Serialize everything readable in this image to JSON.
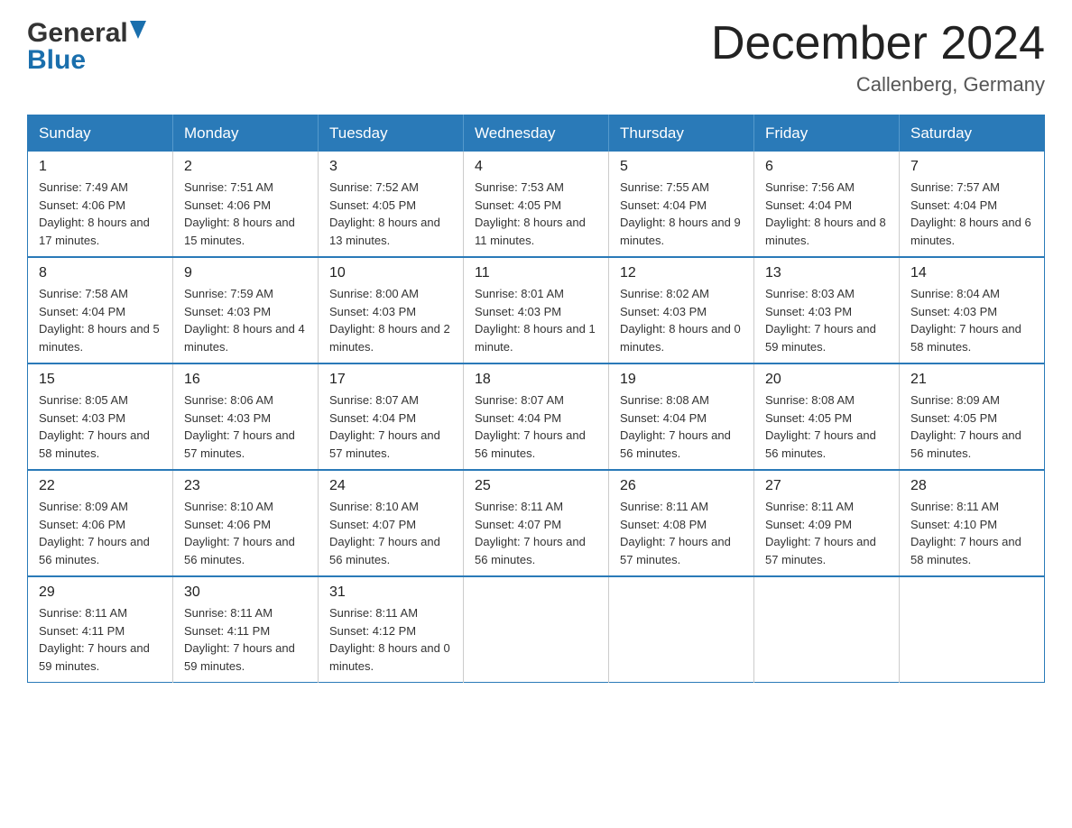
{
  "header": {
    "logo_general": "General",
    "logo_blue": "Blue",
    "month_title": "December 2024",
    "location": "Callenberg, Germany"
  },
  "days_of_week": [
    "Sunday",
    "Monday",
    "Tuesday",
    "Wednesday",
    "Thursday",
    "Friday",
    "Saturday"
  ],
  "weeks": [
    [
      {
        "day": "1",
        "sunrise": "7:49 AM",
        "sunset": "4:06 PM",
        "daylight": "8 hours and 17 minutes."
      },
      {
        "day": "2",
        "sunrise": "7:51 AM",
        "sunset": "4:06 PM",
        "daylight": "8 hours and 15 minutes."
      },
      {
        "day": "3",
        "sunrise": "7:52 AM",
        "sunset": "4:05 PM",
        "daylight": "8 hours and 13 minutes."
      },
      {
        "day": "4",
        "sunrise": "7:53 AM",
        "sunset": "4:05 PM",
        "daylight": "8 hours and 11 minutes."
      },
      {
        "day": "5",
        "sunrise": "7:55 AM",
        "sunset": "4:04 PM",
        "daylight": "8 hours and 9 minutes."
      },
      {
        "day": "6",
        "sunrise": "7:56 AM",
        "sunset": "4:04 PM",
        "daylight": "8 hours and 8 minutes."
      },
      {
        "day": "7",
        "sunrise": "7:57 AM",
        "sunset": "4:04 PM",
        "daylight": "8 hours and 6 minutes."
      }
    ],
    [
      {
        "day": "8",
        "sunrise": "7:58 AM",
        "sunset": "4:04 PM",
        "daylight": "8 hours and 5 minutes."
      },
      {
        "day": "9",
        "sunrise": "7:59 AM",
        "sunset": "4:03 PM",
        "daylight": "8 hours and 4 minutes."
      },
      {
        "day": "10",
        "sunrise": "8:00 AM",
        "sunset": "4:03 PM",
        "daylight": "8 hours and 2 minutes."
      },
      {
        "day": "11",
        "sunrise": "8:01 AM",
        "sunset": "4:03 PM",
        "daylight": "8 hours and 1 minute."
      },
      {
        "day": "12",
        "sunrise": "8:02 AM",
        "sunset": "4:03 PM",
        "daylight": "8 hours and 0 minutes."
      },
      {
        "day": "13",
        "sunrise": "8:03 AM",
        "sunset": "4:03 PM",
        "daylight": "7 hours and 59 minutes."
      },
      {
        "day": "14",
        "sunrise": "8:04 AM",
        "sunset": "4:03 PM",
        "daylight": "7 hours and 58 minutes."
      }
    ],
    [
      {
        "day": "15",
        "sunrise": "8:05 AM",
        "sunset": "4:03 PM",
        "daylight": "7 hours and 58 minutes."
      },
      {
        "day": "16",
        "sunrise": "8:06 AM",
        "sunset": "4:03 PM",
        "daylight": "7 hours and 57 minutes."
      },
      {
        "day": "17",
        "sunrise": "8:07 AM",
        "sunset": "4:04 PM",
        "daylight": "7 hours and 57 minutes."
      },
      {
        "day": "18",
        "sunrise": "8:07 AM",
        "sunset": "4:04 PM",
        "daylight": "7 hours and 56 minutes."
      },
      {
        "day": "19",
        "sunrise": "8:08 AM",
        "sunset": "4:04 PM",
        "daylight": "7 hours and 56 minutes."
      },
      {
        "day": "20",
        "sunrise": "8:08 AM",
        "sunset": "4:05 PM",
        "daylight": "7 hours and 56 minutes."
      },
      {
        "day": "21",
        "sunrise": "8:09 AM",
        "sunset": "4:05 PM",
        "daylight": "7 hours and 56 minutes."
      }
    ],
    [
      {
        "day": "22",
        "sunrise": "8:09 AM",
        "sunset": "4:06 PM",
        "daylight": "7 hours and 56 minutes."
      },
      {
        "day": "23",
        "sunrise": "8:10 AM",
        "sunset": "4:06 PM",
        "daylight": "7 hours and 56 minutes."
      },
      {
        "day": "24",
        "sunrise": "8:10 AM",
        "sunset": "4:07 PM",
        "daylight": "7 hours and 56 minutes."
      },
      {
        "day": "25",
        "sunrise": "8:11 AM",
        "sunset": "4:07 PM",
        "daylight": "7 hours and 56 minutes."
      },
      {
        "day": "26",
        "sunrise": "8:11 AM",
        "sunset": "4:08 PM",
        "daylight": "7 hours and 57 minutes."
      },
      {
        "day": "27",
        "sunrise": "8:11 AM",
        "sunset": "4:09 PM",
        "daylight": "7 hours and 57 minutes."
      },
      {
        "day": "28",
        "sunrise": "8:11 AM",
        "sunset": "4:10 PM",
        "daylight": "7 hours and 58 minutes."
      }
    ],
    [
      {
        "day": "29",
        "sunrise": "8:11 AM",
        "sunset": "4:11 PM",
        "daylight": "7 hours and 59 minutes."
      },
      {
        "day": "30",
        "sunrise": "8:11 AM",
        "sunset": "4:11 PM",
        "daylight": "7 hours and 59 minutes."
      },
      {
        "day": "31",
        "sunrise": "8:11 AM",
        "sunset": "4:12 PM",
        "daylight": "8 hours and 0 minutes."
      },
      null,
      null,
      null,
      null
    ]
  ]
}
